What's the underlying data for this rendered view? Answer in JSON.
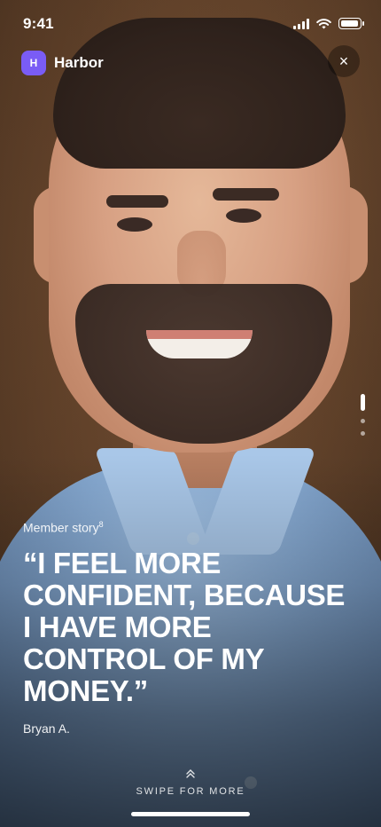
{
  "status_bar": {
    "time": "9:41",
    "icons": [
      "signal-icon",
      "wifi-icon",
      "battery-icon"
    ]
  },
  "header": {
    "logo_text": "H",
    "app_name": "Harbor",
    "close_label": "×"
  },
  "pager": {
    "pages": 3,
    "active_index": 0
  },
  "story": {
    "eyebrow": "Member story",
    "footnote": "8",
    "quote": "“I FEEL MORE CONFIDENT, BECAUSE I HAVE MORE CONTROL OF MY MONEY.”",
    "author": "Bryan A."
  },
  "swipe": {
    "icon": "chevrons-up-icon",
    "label": "SWIPE FOR MORE"
  },
  "colors": {
    "brand": "#7a5cf5",
    "shirt": "#86a9d1",
    "background": "#5a3d27"
  }
}
